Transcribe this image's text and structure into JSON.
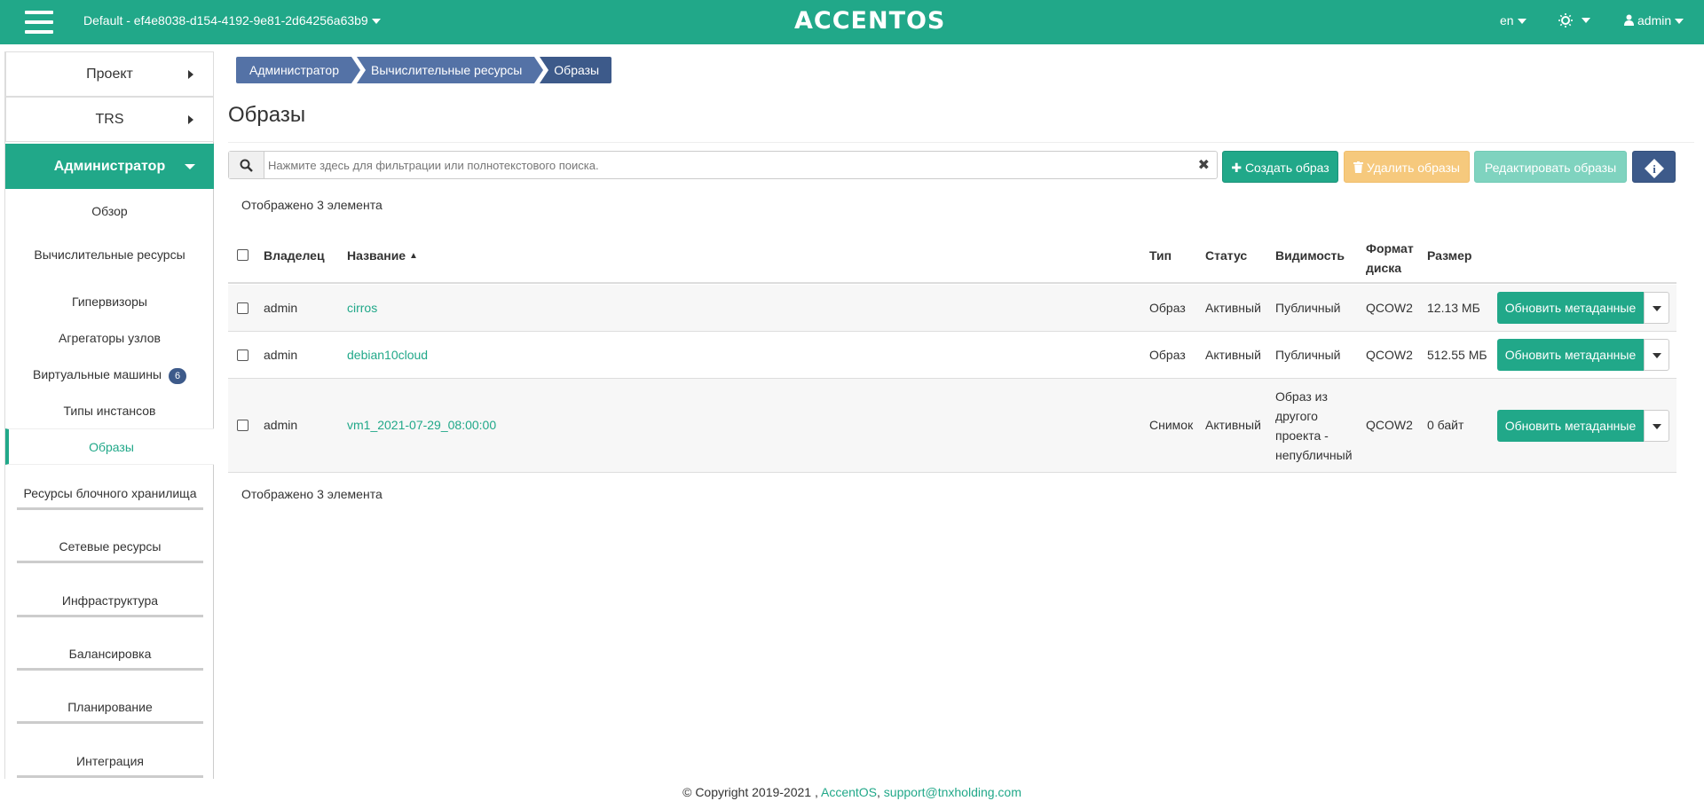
{
  "topbar": {
    "project": "Default - ef4e8038-d154-4192-9e81-2d64256a63b9",
    "logo": "ACCENTOS",
    "lang": "en",
    "user": "admin"
  },
  "sidebar": {
    "panels": [
      {
        "label": "Проект"
      },
      {
        "label": "TRS"
      },
      {
        "label": "Администратор"
      }
    ],
    "admin_items": [
      {
        "label": "Обзор"
      },
      {
        "label": "Вычислительные ресурсы"
      }
    ],
    "compute_items": [
      {
        "label": "Гипервизоры"
      },
      {
        "label": "Агрегаторы узлов"
      },
      {
        "label": "Виртуальные машины",
        "badge": "6"
      },
      {
        "label": "Типы инстансов"
      },
      {
        "label": "Образы"
      }
    ],
    "groups": [
      {
        "label": "Ресурсы блочного хранилища"
      },
      {
        "label": "Сетевые ресурсы"
      },
      {
        "label": "Инфраструктура"
      },
      {
        "label": "Балансировка"
      },
      {
        "label": "Планирование"
      },
      {
        "label": "Интеграция"
      }
    ]
  },
  "breadcrumb": [
    "Администратор",
    "Вычислительные ресурсы",
    "Образы"
  ],
  "page_title": "Образы",
  "search": {
    "placeholder": "Нажмите здесь для фильтрации или полнотекстового поиска."
  },
  "toolbar": {
    "create": "Создать образ",
    "delete": "Удалить образы",
    "edit": "Редактировать образы"
  },
  "count_text": "Отображено 3 элемента",
  "table": {
    "headers": {
      "owner": "Владелец",
      "name": "Название",
      "type": "Тип",
      "status": "Статус",
      "visibility": "Видимость",
      "format_1": "Формат",
      "format_2": "диска",
      "size": "Размер"
    },
    "rows": [
      {
        "owner": "admin",
        "name": "cirros",
        "type": "Образ",
        "status": "Активный",
        "visibility": "Публичный",
        "format": "QCOW2",
        "size": "12.13 МБ",
        "action": "Обновить метаданные"
      },
      {
        "owner": "admin",
        "name": "debian10cloud",
        "type": "Образ",
        "status": "Активный",
        "visibility": "Публичный",
        "format": "QCOW2",
        "size": "512.55 МБ",
        "action": "Обновить метаданные"
      },
      {
        "owner": "admin",
        "name": "vm1_2021-07-29_08:00:00",
        "type": "Снимок",
        "status": "Активный",
        "visibility_lines": [
          "Образ из",
          "другого",
          "проекта -",
          "непубличный"
        ],
        "format": "QCOW2",
        "size": "0 байт",
        "action": "Обновить метаданные"
      }
    ]
  },
  "footer": {
    "copyright": "© Copyright 2019-2021 ,",
    "brand": "AccentOS",
    "sep": ",",
    "email": "support@tnxholding.com"
  },
  "colors": {
    "accent": "#21a889",
    "navy": "#3d5a8a",
    "warning": "#f6c97d"
  }
}
